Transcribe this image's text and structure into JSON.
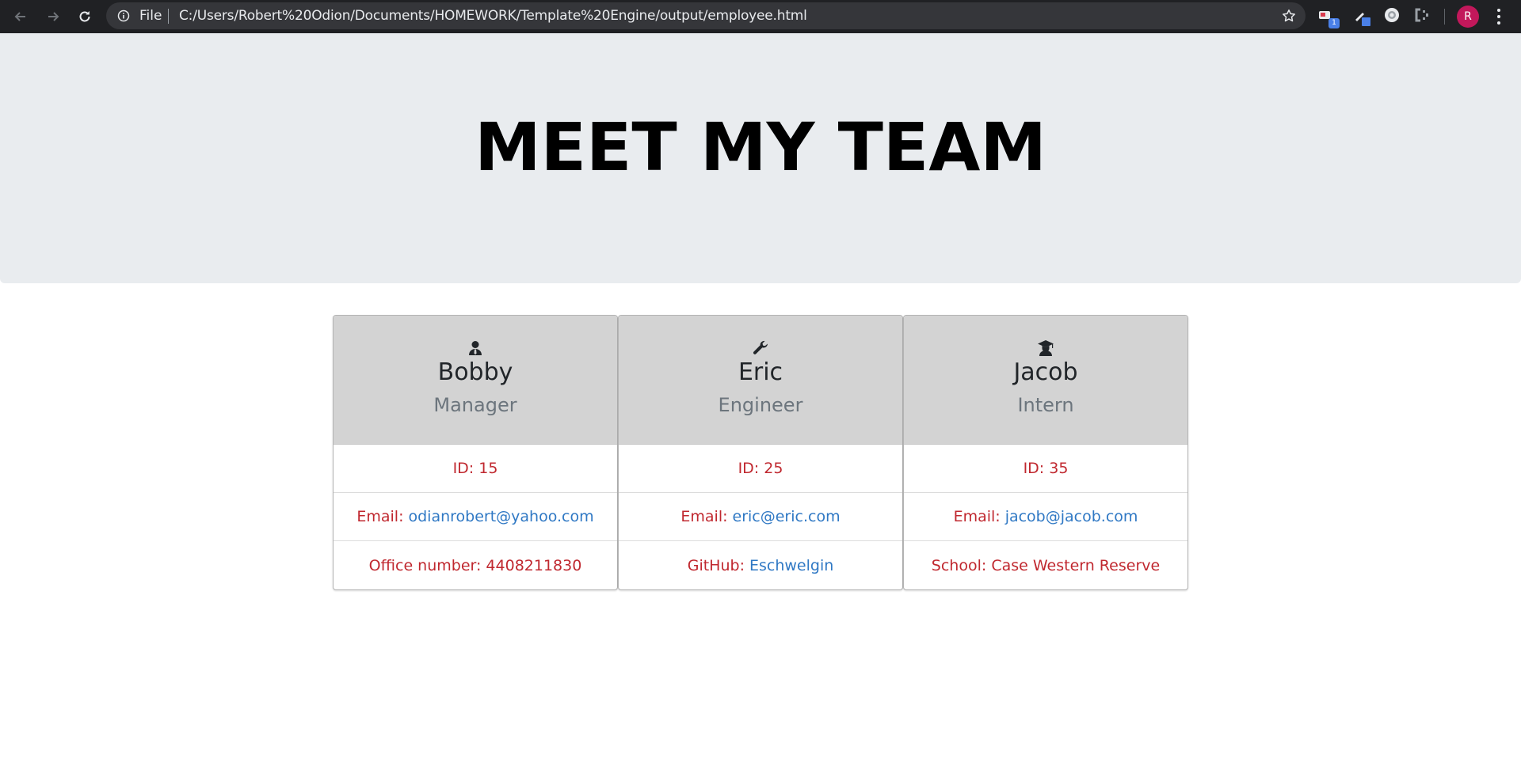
{
  "browser": {
    "file_label": "File",
    "url": "C:/Users/Robert%20Odion/Documents/HOMEWORK/Template%20Engine/output/employee.html",
    "extension_badge": "1",
    "profile_initial": "R"
  },
  "page": {
    "title": "MEET MY TEAM"
  },
  "employees": [
    {
      "icon": "manager-icon",
      "name": "Bobby",
      "role": "Manager",
      "id_text": "ID: 15",
      "email_label": "Email:",
      "email": "odianrobert@yahoo.com",
      "extra_label": "Office number: 4408211830",
      "extra_link": ""
    },
    {
      "icon": "wrench-icon",
      "name": "Eric",
      "role": "Engineer",
      "id_text": "ID: 25",
      "email_label": "Email:",
      "email": "eric@eric.com",
      "extra_label": "GitHub:",
      "extra_link": "Eschwelgin"
    },
    {
      "icon": "graduate-icon",
      "name": "Jacob",
      "role": "Intern",
      "id_text": "ID: 35",
      "email_label": "Email:",
      "email": "jacob@jacob.com",
      "extra_label": "School: Case Western Reserve",
      "extra_link": ""
    }
  ],
  "colors": {
    "jumbotron_bg": "#e9ecef",
    "card_header_bg": "#d3d3d3",
    "text_red": "#c0282f",
    "link_blue": "#2f78c4",
    "role_gray": "#6c757d"
  }
}
